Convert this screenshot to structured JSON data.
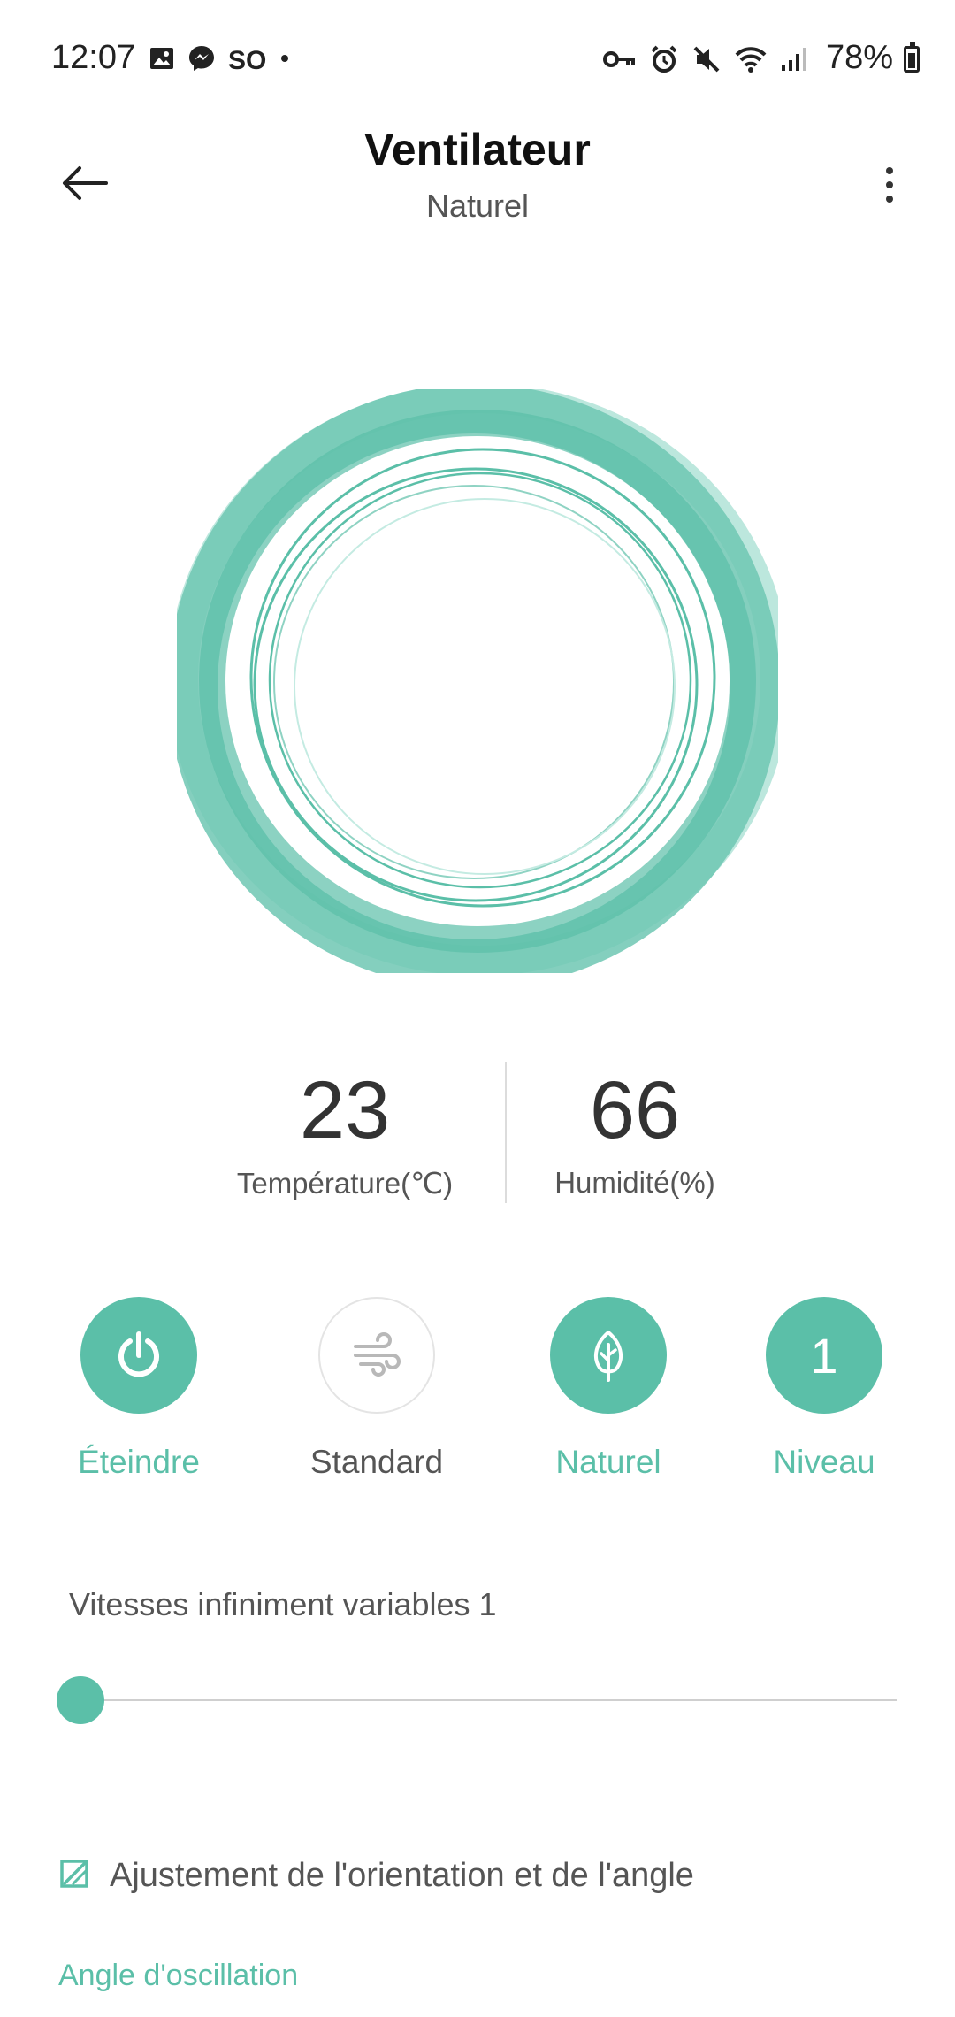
{
  "status_bar": {
    "time": "12:07",
    "left_icons": [
      "image-icon",
      "messenger-icon",
      "so-icon",
      "dot-icon"
    ],
    "right_icons": [
      "vpn-key-icon",
      "alarm-icon",
      "mute-icon",
      "wifi-icon",
      "signal-icon"
    ],
    "so_label": "SO",
    "battery": "78%",
    "battery_level": 0.78
  },
  "header": {
    "title": "Ventilateur",
    "subtitle": "Naturel"
  },
  "readings": {
    "temperature": {
      "value": "23",
      "label": "Température(℃)"
    },
    "humidity": {
      "value": "66",
      "label": "Humidité(%)"
    }
  },
  "controls": [
    {
      "label": "Éteindre",
      "icon": "power-icon",
      "active": true
    },
    {
      "label": "Standard",
      "icon": "wind-icon",
      "active": false
    },
    {
      "label": "Naturel",
      "icon": "leaf-icon",
      "active": true
    },
    {
      "label": "Niveau",
      "icon": "level-icon",
      "value": "1",
      "active": true
    }
  ],
  "speed": {
    "label": "Vitesses infiniment variables 1",
    "fraction": 0
  },
  "orientation": {
    "label": "Ajustement de l'orientation et de l'angle",
    "icon": "edit-square-icon"
  },
  "oscillation": {
    "label": "Angle d'oscillation"
  },
  "colors": {
    "accent": "#5bbfa8",
    "accent_light": "#a6dfd2",
    "text": "#333333",
    "muted": "#555555"
  }
}
